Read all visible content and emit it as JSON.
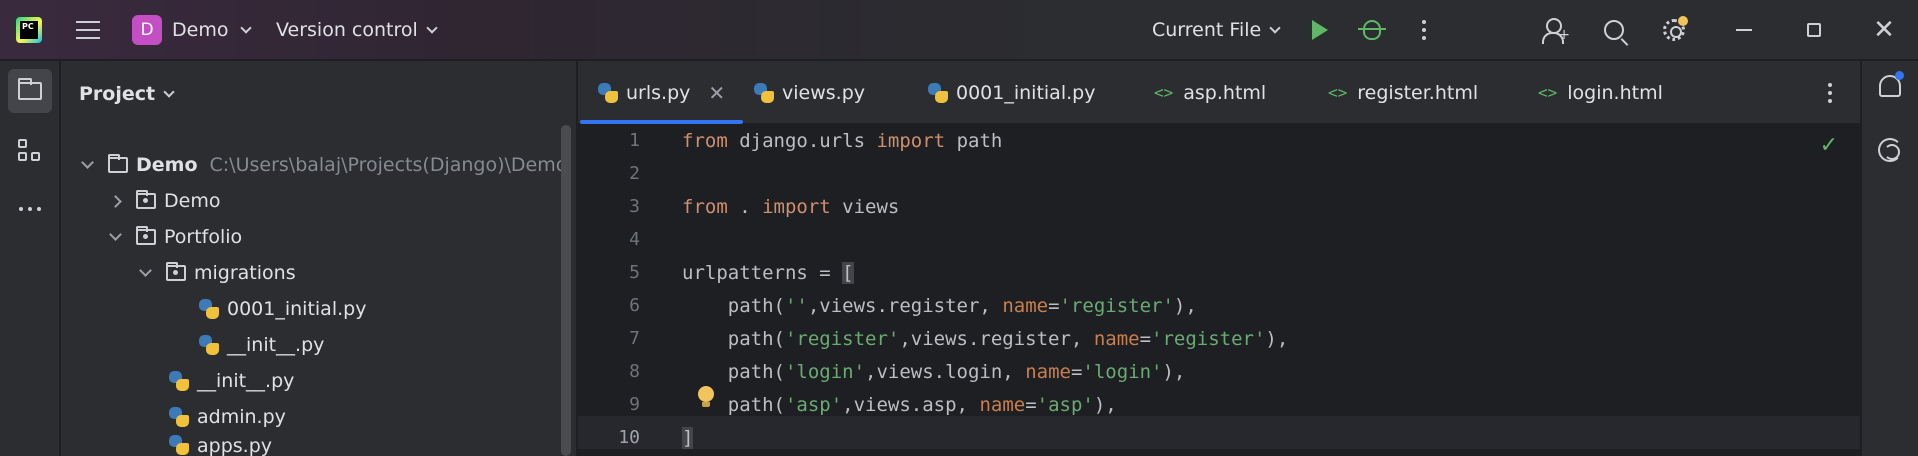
{
  "titlebar": {
    "logo_text": "PC",
    "project_badge": "D",
    "project_name": "Demo",
    "vcs_label": "Version control",
    "run_config": "Current File"
  },
  "panel": {
    "title": "Project"
  },
  "tree": [
    {
      "label": "Demo",
      "path": "C:\\Users\\balaj\\Projects(Django)\\Demo"
    },
    {
      "label": "Demo"
    },
    {
      "label": "Portfolio"
    },
    {
      "label": "migrations"
    },
    {
      "label": "0001_initial.py"
    },
    {
      "label": "__init__.py"
    },
    {
      "label": "__init__.py"
    },
    {
      "label": "admin.py"
    },
    {
      "label": "apps.py"
    }
  ],
  "tabs": [
    {
      "label": "urls.py",
      "icon": "python-icon"
    },
    {
      "label": "views.py",
      "icon": "python-icon"
    },
    {
      "label": "0001_initial.py",
      "icon": "python-icon"
    },
    {
      "label": "asp.html",
      "icon": "html-icon"
    },
    {
      "label": "register.html",
      "icon": "html-icon"
    },
    {
      "label": "login.html",
      "icon": "html-icon"
    }
  ],
  "editor": {
    "line_numbers": [
      "1",
      "2",
      "3",
      "4",
      "5",
      "6",
      "7",
      "8",
      "9",
      "10"
    ],
    "tokens": {
      "l1_from": "from",
      "l1_mod": " django.urls ",
      "l1_import": "import",
      "l1_rest": " path",
      "l3_from": "from",
      "l3_dot": " . ",
      "l3_import": "import",
      "l3_rest": " views",
      "l5_text": "urlpatterns = ",
      "l5_bracket": "[",
      "l6_a": "    path(",
      "l6_s1": "''",
      "l6_b": ",views.register, ",
      "l6_p": "name",
      "l6_eq": "=",
      "l6_s2": "'register'",
      "l6_c": "),",
      "l7_a": "    path(",
      "l7_s1": "'register'",
      "l7_b": ",views.register, ",
      "l7_p": "name",
      "l7_eq": "=",
      "l7_s2": "'register'",
      "l7_c": "),",
      "l8_a": "    path(",
      "l8_s1": "'login'",
      "l8_b": ",views.login, ",
      "l8_p": "name",
      "l8_eq": "=",
      "l8_s2": "'login'",
      "l8_c": "),",
      "l9_a": "    path(",
      "l9_s1": "'asp'",
      "l9_b": ",views.asp, ",
      "l9_p": "name",
      "l9_eq": "=",
      "l9_s2": "'asp'",
      "l9_c": "),",
      "l10_bracket": "]"
    }
  },
  "colors": {
    "accent": "#3574f0",
    "keyword": "#cf8e6d",
    "string": "#6aab73",
    "param": "#c77f4f",
    "run_green": "#5fb865"
  }
}
